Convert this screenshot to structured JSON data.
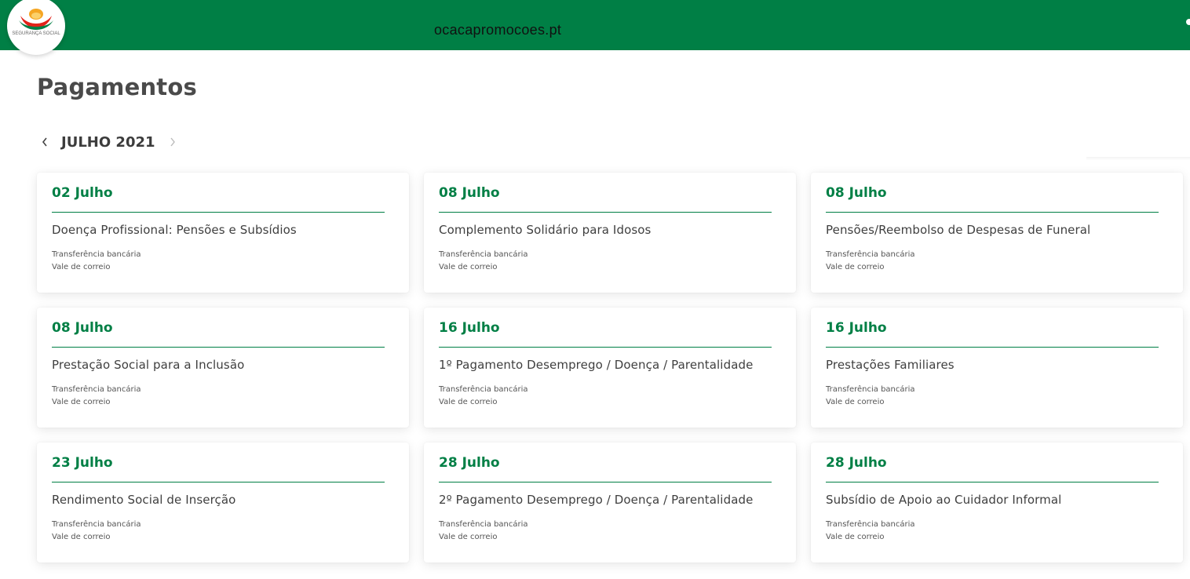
{
  "header": {
    "site_url": "ocacapromocoes.pt",
    "logo_text": "SEGURANÇA SOCIAL",
    "bar_color": "#007f45"
  },
  "page": {
    "title": "Pagamentos"
  },
  "month_nav": {
    "label": "JULHO 2021",
    "prev_icon": "chevron-left-icon",
    "next_icon": "chevron-right-icon"
  },
  "colors": {
    "accent": "#007f45",
    "text": "#4a4a4a"
  },
  "payments": [
    {
      "date": "02 Julho",
      "title": "Doença Profissional: Pensões e Subsídios",
      "methods": [
        "Transferência bancária",
        "Vale de correio"
      ]
    },
    {
      "date": "08 Julho",
      "title": "Complemento Solidário para Idosos",
      "methods": [
        "Transferência bancária",
        "Vale de correio"
      ]
    },
    {
      "date": "08 Julho",
      "title": "Pensões/Reembolso de Despesas de Funeral",
      "methods": [
        "Transferência bancária",
        "Vale de correio"
      ]
    },
    {
      "date": "08 Julho",
      "title": "Prestação Social para a Inclusão",
      "methods": [
        "Transferência bancária",
        "Vale de correio"
      ]
    },
    {
      "date": "16 Julho",
      "title": "1º Pagamento Desemprego / Doença / Parentalidade",
      "methods": [
        "Transferência bancária",
        "Vale de correio"
      ]
    },
    {
      "date": "16 Julho",
      "title": "Prestações Familiares",
      "methods": [
        "Transferência bancária",
        "Vale de correio"
      ]
    },
    {
      "date": "23 Julho",
      "title": "Rendimento Social de Inserção",
      "methods": [
        "Transferência bancária",
        "Vale de correio"
      ]
    },
    {
      "date": "28 Julho",
      "title": "2º Pagamento Desemprego / Doença / Parentalidade",
      "methods": [
        "Transferência bancária",
        "Vale de correio"
      ]
    },
    {
      "date": "28 Julho",
      "title": "Subsídio de Apoio ao Cuidador Informal",
      "methods": [
        "Transferência bancária",
        "Vale de correio"
      ]
    }
  ]
}
